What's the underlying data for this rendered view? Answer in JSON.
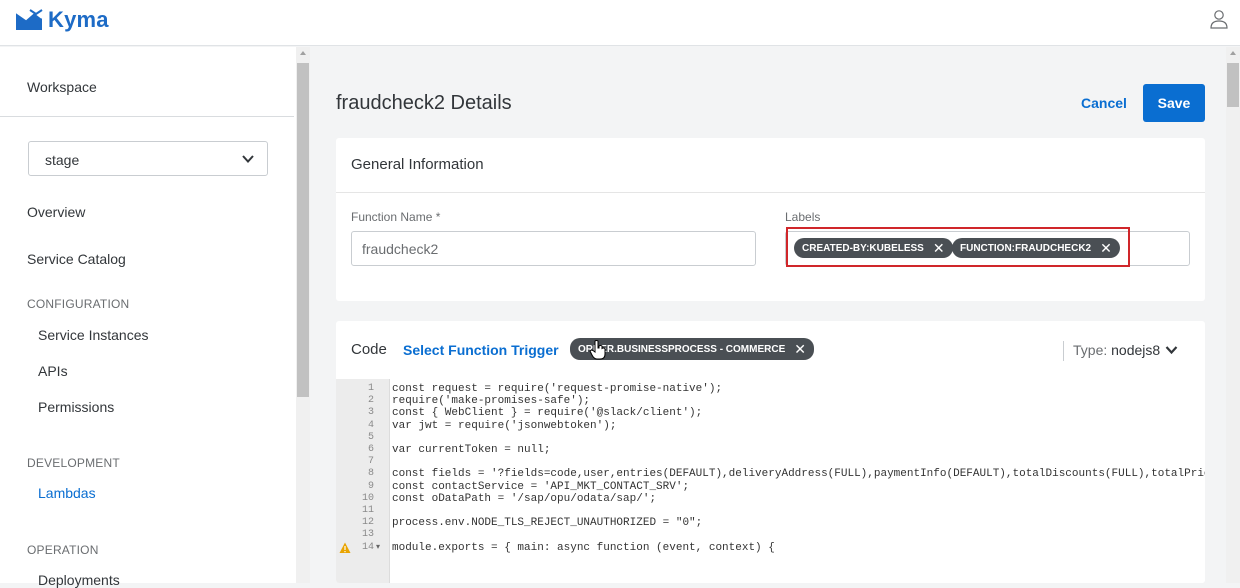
{
  "app": {
    "name": "Kyma"
  },
  "sidebar": {
    "workspace": "Workspace",
    "namespace_select": "stage",
    "overview": "Overview",
    "service_catalog": "Service Catalog",
    "configuration_header": "CONFIGURATION",
    "service_instances": "Service Instances",
    "apis": "APIs",
    "permissions": "Permissions",
    "development_header": "DEVELOPMENT",
    "lambdas": "Lambdas",
    "operation_header": "OPERATION",
    "deployments": "Deployments"
  },
  "page": {
    "title": "fraudcheck2 Details",
    "cancel_label": "Cancel",
    "save_label": "Save"
  },
  "general": {
    "title": "General Information",
    "function_name_label": "Function Name *",
    "function_name_value": "fraudcheck2",
    "labels_label": "Labels",
    "labels": [
      "CREATED-BY:KUBELESS",
      "FUNCTION:FRAUDCHECK2"
    ]
  },
  "code_section": {
    "title": "Code",
    "trigger_link": "Select Function Trigger",
    "trigger_chip": "ORDER.BUSINESSPROCESS - COMMERCE",
    "type_label": "Type:",
    "type_value": "nodejs8"
  },
  "code_lines": [
    {
      "n": "1",
      "text": "const request = require('request-promise-native');"
    },
    {
      "n": "2",
      "text": "require('make-promises-safe');"
    },
    {
      "n": "3",
      "text": "const { WebClient } = require('@slack/client');"
    },
    {
      "n": "4",
      "text": "var jwt = require('jsonwebtoken');"
    },
    {
      "n": "5",
      "text": ""
    },
    {
      "n": "6",
      "text": "var currentToken = null;"
    },
    {
      "n": "7",
      "text": ""
    },
    {
      "n": "8",
      "text": "const fields = '?fields=code,user,entries(DEFAULT),deliveryAddress(FULL),paymentInfo(DEFAULT),totalDiscounts(FULL),totalPrice(F"
    },
    {
      "n": "9",
      "text": "const contactService = 'API_MKT_CONTACT_SRV';"
    },
    {
      "n": "10",
      "text": "const oDataPath = '/sap/opu/odata/sap/';"
    },
    {
      "n": "11",
      "text": ""
    },
    {
      "n": "12",
      "text": "process.env.NODE_TLS_REJECT_UNAUTHORIZED = \"0\";"
    },
    {
      "n": "13",
      "text": ""
    },
    {
      "n": "14",
      "text": "module.exports = { main: async function (event, context) {"
    }
  ],
  "colors": {
    "accent": "#0a6ed1",
    "highlight_border": "#d0262a",
    "chip_bg": "#4a4f54"
  }
}
